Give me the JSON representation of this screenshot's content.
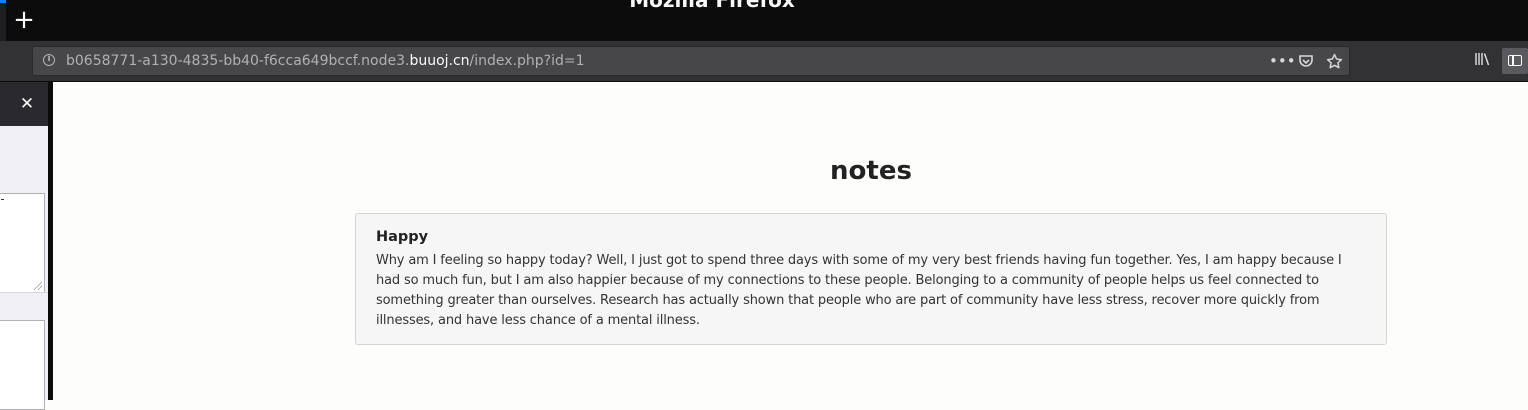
{
  "browser": {
    "window_title": "Mozilla Firefox",
    "new_tab_label": "+",
    "url": {
      "prefix": "b0658771-a130-4835-bb40-f6cca649bccf.node3.",
      "host": "buuoj.cn",
      "path": "/index.php?id=1"
    },
    "icons": {
      "site_info": "info-icon",
      "page_actions": "ellipsis-icon",
      "pocket": "pocket-icon",
      "bookmark": "star-icon",
      "library": "library-icon",
      "sidebar": "sidebar-icon",
      "close": "close-icon"
    }
  },
  "sidebar": {
    "close_label": "✕"
  },
  "page": {
    "title": "notes",
    "notes": [
      {
        "title": "Happy",
        "body": "Why am I feeling so happy today? Well, I just got to spend three days with some of my very best friends having fun together. Yes, I am happy because I had so much fun, but I am also happier because of my connections to these people. Belonging to a community of people helps us feel connected to something greater than ourselves. Research has actually shown that people who are part of community have less stress, recover more quickly from illnesses, and have less chance of a mental illness."
      }
    ]
  }
}
